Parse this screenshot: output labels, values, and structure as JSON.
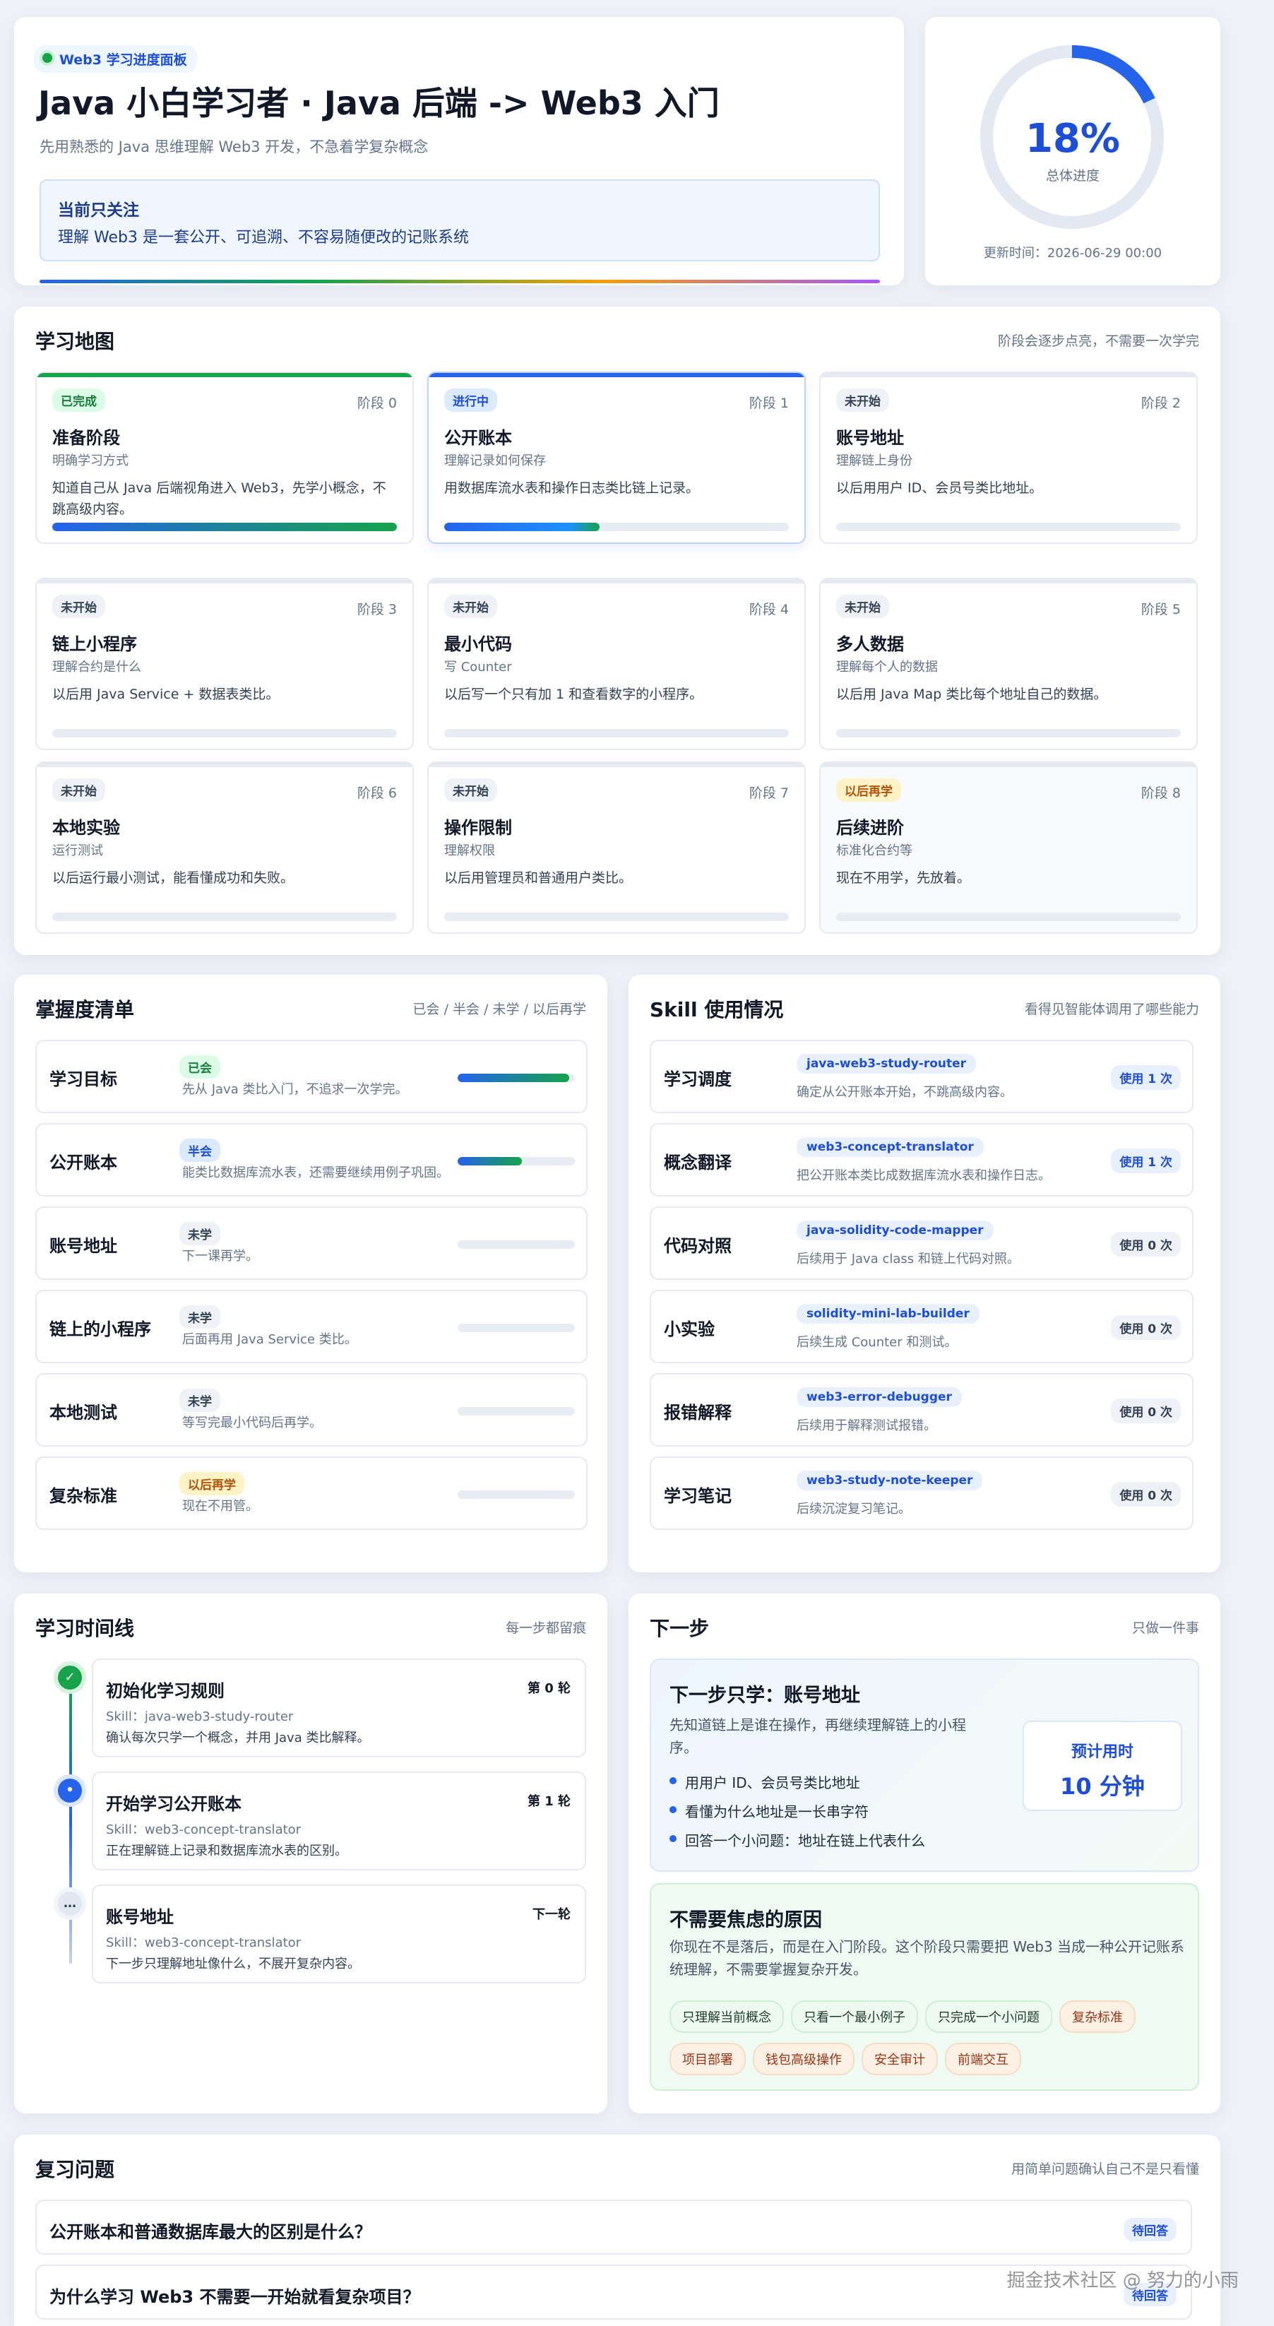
{
  "header": {
    "tag": "Web3 学习进度面板",
    "title": "Java 小白学习者 · Java 后端 -> Web3 入门",
    "subtitle": "先用熟悉的 Java 思维理解 Web3 开发，不急着学复杂概念",
    "focus_label": "当前只关注",
    "focus_text": "理解 Web3 是一套公开、可追溯、不容易随便改的记账系统"
  },
  "progress": {
    "percent_text": "18%",
    "percent": 0.18,
    "label": "总体进度",
    "updated": "更新时间：2026-06-29 00:00"
  },
  "map": {
    "title": "学习地图",
    "hint": "阶段会逐步点亮，不需要一次学完",
    "stages": [
      {
        "badge": "已完成",
        "num": "阶段 0",
        "title": "准备阶段",
        "sub": "明确学习方式",
        "desc": "知道自己从 Java 后端视角进入 Web3，先学小概念，不跳高级内容。",
        "fill": 1.0
      },
      {
        "badge": "进行中",
        "num": "阶段 1",
        "title": "公开账本",
        "sub": "理解记录如何保存",
        "desc": "用数据库流水表和操作日志类比链上记录。",
        "fill": 0.45
      },
      {
        "badge": "未开始",
        "num": "阶段 2",
        "title": "账号地址",
        "sub": "理解链上身份",
        "desc": "以后用用户 ID、会员号类比地址。",
        "fill": 0
      },
      {
        "badge": "未开始",
        "num": "阶段 3",
        "title": "链上小程序",
        "sub": "理解合约是什么",
        "desc": "以后用 Java Service + 数据表类比。",
        "fill": 0
      },
      {
        "badge": "未开始",
        "num": "阶段 4",
        "title": "最小代码",
        "sub": "写 Counter",
        "desc": "以后写一个只有加 1 和查看数字的小程序。",
        "fill": 0
      },
      {
        "badge": "未开始",
        "num": "阶段 5",
        "title": "多人数据",
        "sub": "理解每个人的数据",
        "desc": "以后用 Java Map 类比每个地址自己的数据。",
        "fill": 0
      },
      {
        "badge": "未开始",
        "num": "阶段 6",
        "title": "本地实验",
        "sub": "运行测试",
        "desc": "以后运行最小测试，能看懂成功和失败。",
        "fill": 0
      },
      {
        "badge": "未开始",
        "num": "阶段 7",
        "title": "操作限制",
        "sub": "理解权限",
        "desc": "以后用管理员和普通用户类比。",
        "fill": 0
      },
      {
        "badge": "以后再学",
        "num": "阶段 8",
        "title": "后续进阶",
        "sub": "标准化合约等",
        "desc": "现在不用学，先放着。",
        "fill": 0
      }
    ]
  },
  "mastery": {
    "title": "掌握度清单",
    "hint": "已会 / 半会 / 未学 / 以后再学",
    "rows": [
      {
        "name": "学习目标",
        "badge": "已会",
        "desc": "先从 Java 类比入门，不追求一次学完。",
        "fill": 0.95
      },
      {
        "name": "公开账本",
        "badge": "半会",
        "desc": "能类比数据库流水表，还需要继续用例子巩固。",
        "fill": 0.55
      },
      {
        "name": "账号地址",
        "badge": "未学",
        "desc": "下一课再学。",
        "fill": 0
      },
      {
        "name": "链上的小程序",
        "badge": "未学",
        "desc": "后面再用 Java Service 类比。",
        "fill": 0
      },
      {
        "name": "本地测试",
        "badge": "未学",
        "desc": "等写完最小代码后再学。",
        "fill": 0
      },
      {
        "name": "复杂标准",
        "badge": "以后再学",
        "desc": "现在不用管。",
        "fill": 0
      }
    ]
  },
  "skills": {
    "title": "Skill 使用情况",
    "hint": "看得见智能体调用了哪些能力",
    "rows": [
      {
        "name": "学习调度",
        "tag": "java-web3-study-router",
        "desc": "确定从公开账本开始，不跳高级内容。",
        "count": "使用 1 次"
      },
      {
        "name": "概念翻译",
        "tag": "web3-concept-translator",
        "desc": "把公开账本类比成数据库流水表和操作日志。",
        "count": "使用 1 次"
      },
      {
        "name": "代码对照",
        "tag": "java-solidity-code-mapper",
        "desc": "后续用于 Java class 和链上代码对照。",
        "count": "使用 0 次"
      },
      {
        "name": "小实验",
        "tag": "solidity-mini-lab-builder",
        "desc": "后续生成 Counter 和测试。",
        "count": "使用 0 次"
      },
      {
        "name": "报错解释",
        "tag": "web3-error-debugger",
        "desc": "后续用于解释测试报错。",
        "count": "使用 0 次"
      },
      {
        "name": "学习笔记",
        "tag": "web3-study-note-keeper",
        "desc": "后续沉淀复习笔记。",
        "count": "使用 0 次"
      }
    ]
  },
  "timeline": {
    "title": "学习时间线",
    "hint": "每一步都留痕",
    "items": [
      {
        "icon": "✓",
        "title": "初始化学习规则",
        "round": "第 0 轮",
        "skill": "Skill：java-web3-study-router",
        "desc": "确认每次只学一个概念，并用 Java 类比解释。"
      },
      {
        "icon": "•",
        "title": "开始学习公开账本",
        "round": "第 1 轮",
        "skill": "Skill：web3-concept-translator",
        "desc": "正在理解链上记录和数据库流水表的区别。"
      },
      {
        "icon": "…",
        "title": "账号地址",
        "round": "下一轮",
        "skill": "Skill：web3-concept-translator",
        "desc": "下一步只理解地址像什么，不展开复杂内容。"
      }
    ]
  },
  "next": {
    "title": "下一步",
    "hint": "只做一件事",
    "heading": "下一步只学：账号地址",
    "desc": "先知道链上是谁在操作，再继续理解链上的小程序。",
    "bullets": [
      "用用户 ID、会员号类比地址",
      "看懂为什么地址是一长串字符",
      "回答一个小问题：地址在链上代表什么"
    ],
    "time_label": "预计用时",
    "time_value": "10 分钟",
    "calm_title": "不需要焦虑的原因",
    "calm_desc": "你现在不是落后，而是在入门阶段。这个阶段只需要把 Web3 当成一种公开记账系统理解，不需要掌握复杂开发。",
    "chips_green": [
      "只理解当前概念",
      "只看一个最小例子",
      "只完成一个小问题"
    ],
    "chips_orange": [
      "复杂标准",
      "项目部署",
      "钱包高级操作",
      "安全审计",
      "前端交互"
    ]
  },
  "review": {
    "title": "复习问题",
    "hint": "用简单问题确认自己不是只看懂",
    "questions": [
      {
        "q": "公开账本和普通数据库最大的区别是什么？",
        "status": "待回答"
      },
      {
        "q": "为什么学习 Web3 不需要一开始就看复杂项目？",
        "status": "待回答"
      }
    ]
  },
  "watermark": "掘金技术社区 @ 努力的小雨",
  "colors": {
    "accent": "#2563eb",
    "done": "#16a34a",
    "later": "#b45309"
  }
}
